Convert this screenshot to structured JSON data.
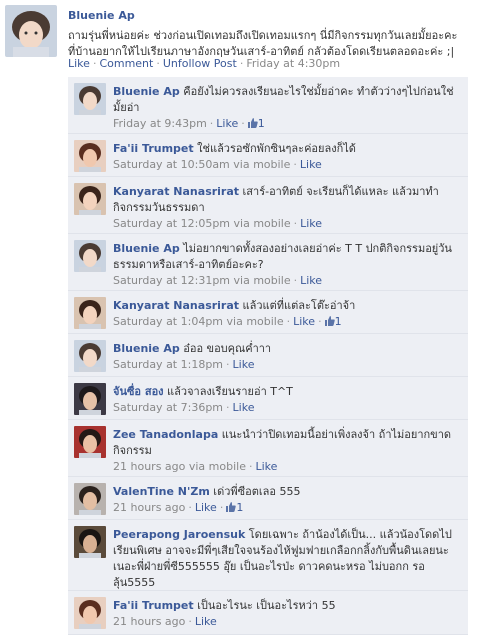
{
  "post": {
    "author": "Bluenie Ap",
    "text": "ถามรุ่นพี่หน่อยค่ะ ช่วงก่อนเปิดเทอมถึงเปิดเทอมแรกๆ นี่มีกิจกรรมทุกวันเลยมั้ยอะคะ ที่บ้านอยากให้ไปเรียนภาษาอังกฤษวันเสาร์-อาทิตย์ กลัวต้องโดดเรียนตลอดอะค่ะ ;|",
    "actions": {
      "like": "Like",
      "comment": "Comment",
      "unfollow": "Unfollow Post",
      "time": "Friday at 4:30pm"
    }
  },
  "comments": [
    {
      "name": "Bluenie Ap",
      "text": "คือยังไม่ควรลงเรียนอะไรใช่มั้ยอ่าคะ ทำตัวว่างๆไปก่อนใช่มั้ยอ่า",
      "time": "Friday at 9:43pm",
      "via": "",
      "like": "Like",
      "likes": "1",
      "avatar": "blue"
    },
    {
      "name": "Fa'ii Trumpet",
      "text": "ใช่แล้วรอซักพักซินๆละค่อยลงก็ได้",
      "time": "Saturday at 10:50am",
      "via": "via mobile",
      "like": "Like",
      "likes": "",
      "avatar": "faii"
    },
    {
      "name": "Kanyarat Nanasrirat",
      "text": "เสาร์-อาทิตย์ จะเรียนก็ได้แหละ แล้วมาทำกิจกรรมวันธรรมดา",
      "time": "Saturday at 12:05pm",
      "via": "via mobile",
      "like": "Like",
      "likes": "",
      "avatar": "kany"
    },
    {
      "name": "Bluenie Ap",
      "text": "ไม่อยากขาดทั้งสองอย่างเลยอ่าค่ะ T T ปกติกิจกรรมอยู่วันธรรมดาหรือเสาร์-อาทิตย์อะคะ?",
      "time": "Saturday at 12:31pm",
      "via": "via mobile",
      "like": "Like",
      "likes": "",
      "avatar": "blue"
    },
    {
      "name": "Kanyarat Nanasrirat",
      "text": "แล้วแต่ที่แต่ละโต๊ะอ่าจ้า",
      "time": "Saturday at 1:04pm",
      "via": "via mobile",
      "like": "Like",
      "likes": "1",
      "avatar": "kany"
    },
    {
      "name": "Bluenie Ap",
      "text": "อ๋ออ ขอบคุณค่ำาา",
      "time": "Saturday at 1:18pm",
      "via": "",
      "like": "Like",
      "likes": "",
      "avatar": "blue"
    },
    {
      "name": "จันซื่อ สอง",
      "text": "แล้วจาลงเรียนรายอ่า T^T",
      "time": "Saturday at 7:36pm",
      "via": "",
      "like": "Like",
      "likes": "",
      "avatar": "jan"
    },
    {
      "name": "Zee Tanadonlapa",
      "text": "แนะนำว่าปิดเทอมนี้อย่าเพิ่งลงจ้า ถ้าไม่อยากขาดกิจกรรม",
      "time": "21 hours ago",
      "via": "via mobile",
      "like": "Like",
      "likes": "",
      "avatar": "zee"
    },
    {
      "name": "ValenTine N'Zm",
      "text": "เด่วพี่ซีอตเลอ 555",
      "time": "21 hours ago",
      "via": "",
      "like": "Like",
      "likes": "1",
      "avatar": "val"
    },
    {
      "name": "Peerapong Jaroensuk",
      "text": "โดยเฉพาะ ถ้าน้องได้เป็น... แล้วน้องโดดไปเรียนพิเศษ อาจจะมีพี่ๆเสียใจจนร้องไห้ฟูมฟายเกลือกกลิ้งกับพื้นดินเลยนะ เนอะพี่ฝ่ายพี่ซี555555 อุ๊ย เป็นอะไรป่ะ ดาวคดนะหรอ ไม่บอกก รอลุ้น5555",
      "time": "21 hours ago",
      "via": "",
      "like": "Like",
      "likes": "",
      "avatar": "peer"
    },
    {
      "name": "Fa'ii Trumpet",
      "text": "เป็นอะไรนะ เป็นอะไรหว่า 55",
      "time": "21 hours ago",
      "via": "",
      "like": "Like",
      "likes": "",
      "avatar": "faii"
    }
  ]
}
